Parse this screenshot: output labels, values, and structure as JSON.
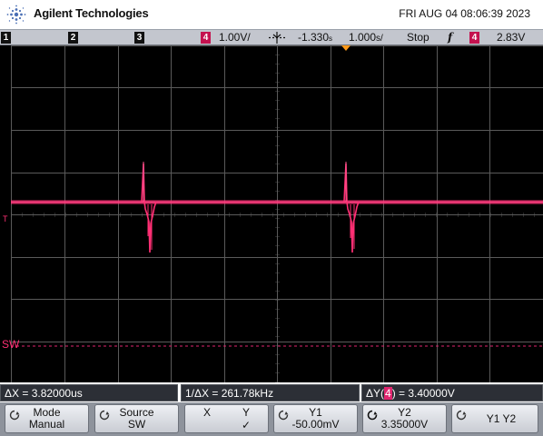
{
  "header": {
    "brand": "Agilent Technologies",
    "datetime": "FRI AUG 04 08:06:39 2023"
  },
  "status_bar": {
    "channels": [
      {
        "label": "1",
        "color": "#111111"
      },
      {
        "label": "2",
        "color": "#111111"
      },
      {
        "label": "3",
        "color": "#111111"
      },
      {
        "label": "4",
        "color": "#c4124f"
      }
    ],
    "ch4_scale": "1.00V/",
    "time_offset": "-1.330",
    "time_offset_unit": "s",
    "time_scale": "1.000",
    "time_scale_unit": "s/",
    "run_state": "Stop",
    "trigger_edge": "f",
    "trigger_channel": "4",
    "trigger_level": "2.83V"
  },
  "screen": {
    "trace_color": "#ff2f74",
    "cursor_label": "SW",
    "ground_marker": "T"
  },
  "measurements": {
    "delta_x": "ΔX = 3.82000us",
    "inv_delta_x": "1/ΔX = 261.78kHz",
    "delta_y_prefix": "ΔY(",
    "delta_y_channel": "4",
    "delta_y_suffix": ") = 3.40000V"
  },
  "softkeys": {
    "mode_label": "Mode",
    "mode_value": "Manual",
    "source_label": "Source",
    "source_value": "SW",
    "x_label": "X",
    "y_label": "Y",
    "y_check": "✓",
    "y1_label": "Y1",
    "y1_value": "-50.00mV",
    "y2_label": "Y2",
    "y2_value": "3.35000V",
    "y1y2_label": "Y1 Y2"
  },
  "icons": {
    "logo": "agilent-spark-icon",
    "trigger_marker": "trigger-position-icon",
    "knob": "rotary-knob-icon",
    "edge": "falling-edge-icon"
  }
}
